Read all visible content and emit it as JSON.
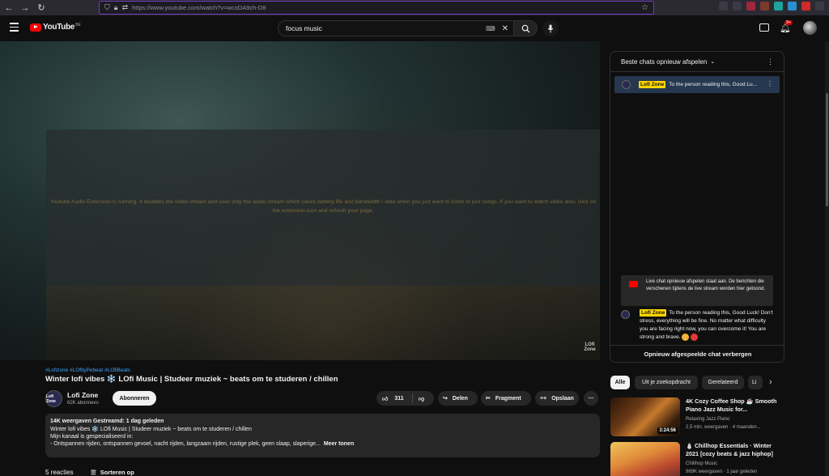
{
  "browser": {
    "url": "https://www.youtube.com/watch?v=wcoDA9ch-D8"
  },
  "masthead": {
    "logo": "YouTube",
    "country": "BE",
    "search_value": "focus music",
    "notification_count": "9+"
  },
  "player": {
    "extension_message": "Youtube Audio Extension is running. It disables the video stream and uses only the audio stream which saves battery life and bandwidth / data when you just want to listen to just songs. If you want to watch video also, click on the extension icon and refresh your page.",
    "watermark": "LOfi Zone"
  },
  "video": {
    "hashtags": "#Lofizone #LOfityPebeat #LOfiBeats",
    "title": "Winter lofi vibes ❄️ LOfi Music | Studeer muziek ~ beats om te studeren / chillen",
    "channel_avatar_text": "Lofi Zone",
    "channel_name": "Lofi Zone",
    "subscribers": "62K abonnees",
    "subscribe_label": "Abonneren",
    "likes": "311",
    "share_label": "Delen",
    "clip_label": "Fragment",
    "save_label": "Opslaan",
    "more_label": "⋯"
  },
  "description": {
    "meta": "14K weergaven  Gestreamd: 1 dag geleden",
    "line1": "Winter lofi vibes ❄️ LOfi Music | Studeer muziek ~ beats om te studeren / chillen",
    "line2": "Mijn kanaal is gespecialiseerd in:",
    "line3": "- Ontspannen rijden, ontspannen gevoel, nacht rijden, langzaam rijden, rustige plek, geen slaap, slaperige...",
    "more": "Meer tonen"
  },
  "comments": {
    "count": "5 reacties",
    "sort_label": "Sorteren op"
  },
  "chat": {
    "header": "Beste chats opnieuw afspelen",
    "pinned_author": "Lofi Zone",
    "pinned_message": "To the person reading this, Good Lu...",
    "notice": "Live chat opnieuw afspelen staat aan. De berichten die verschenen tijdens de live stream worden hier getoond.",
    "message_author": "Lofi Zone",
    "message_text": "To the person reading this, Good Luck! Don't stress, everything will be fine. No matter what difficulty you are facing right now, you can overcome it! You are strong and brave.",
    "footer": "Opnieuw afgespeelde chat verbergen"
  },
  "filters": [
    "Alle",
    "Uit je zoekopdracht",
    "Gerelateerd",
    "Li"
  ],
  "recommendations": [
    {
      "title": "4K Cozy Coffee Shop ☕ Smooth Piano Jazz Music for...",
      "channel": "Relaxing Jazz Piano",
      "stats": "2,5 mln. weergaven  ·  4 maanden...",
      "duration": "3:24:56"
    },
    {
      "title": "⛄ Chillhop Essentials · Winter 2021 [cozy beats & jazz hiphop]",
      "channel": "Chillhop Music",
      "stats": "969K weergaven  ·  1 jaar geleden",
      "duration": ""
    }
  ],
  "colors": {
    "accent": "#3ea6ff",
    "brand": "#ff0000",
    "chip_active": "#f1f1f1",
    "pinned_bg": "#263850",
    "badge": "#ffd600"
  }
}
